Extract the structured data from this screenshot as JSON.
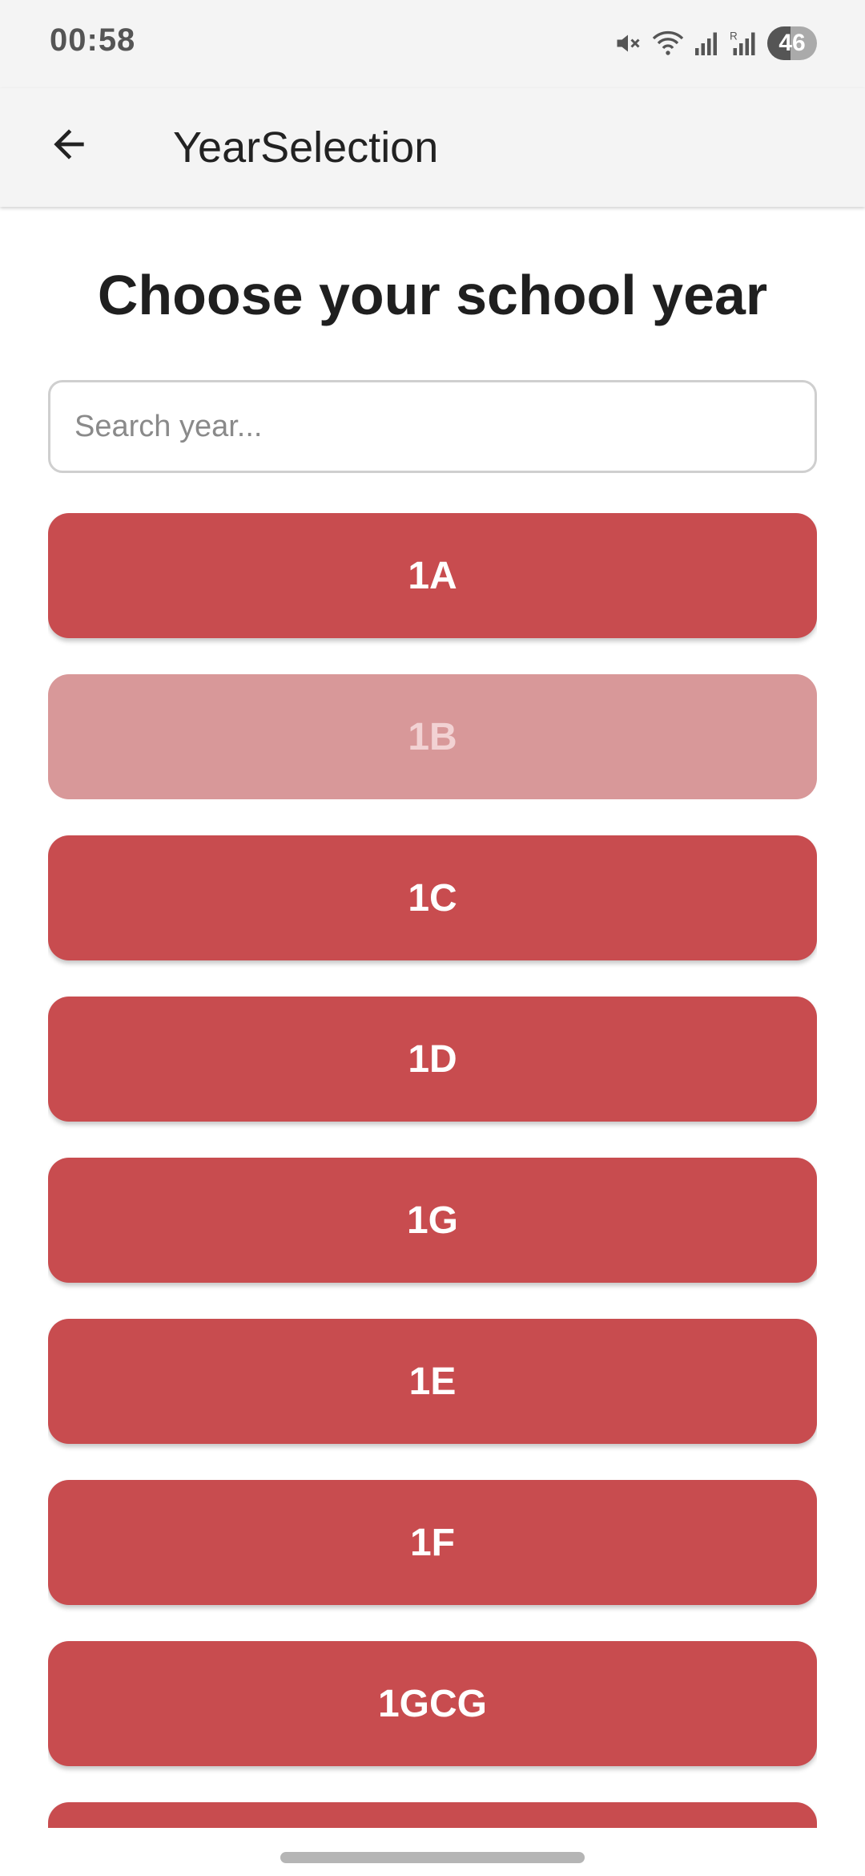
{
  "status_bar": {
    "time": "00:58",
    "battery_level": "46",
    "battery_fraction": 0.46,
    "icons": [
      "mute-icon",
      "wifi-icon",
      "signal-icon",
      "signal-roaming-icon",
      "battery-icon"
    ]
  },
  "app_bar": {
    "title": "YearSelection",
    "back_icon": "arrow-back-icon"
  },
  "main": {
    "heading": "Choose your school year",
    "search": {
      "placeholder": "Search year...",
      "value": ""
    },
    "years": [
      {
        "label": "1A",
        "enabled": true
      },
      {
        "label": "1B",
        "enabled": false
      },
      {
        "label": "1C",
        "enabled": true
      },
      {
        "label": "1D",
        "enabled": true
      },
      {
        "label": "1G",
        "enabled": true
      },
      {
        "label": "1E",
        "enabled": true
      },
      {
        "label": "1F",
        "enabled": true
      },
      {
        "label": "1GCG",
        "enabled": true
      },
      {
        "label": "",
        "enabled": true
      }
    ]
  },
  "colors": {
    "button": "#c84c4f",
    "button_disabled": "#d89899",
    "app_bar": "#f4f4f4"
  }
}
